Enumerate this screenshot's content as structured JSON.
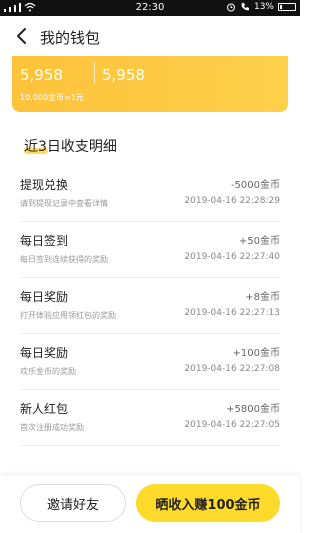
{
  "status_bar": {
    "time": "22:30",
    "battery": "13%"
  },
  "header": {
    "title": "我的钱包"
  },
  "balance_card": {
    "coins": "5,958",
    "coins_secondary": "5,958",
    "rate_text": "10,000金币=1元"
  },
  "section": {
    "title": "近3日收支明细"
  },
  "records": [
    {
      "title": "提现兑换",
      "desc": "请到提现记录中查看详情",
      "amount": "-5000金币",
      "time": "2019-04-16 22:28:29"
    },
    {
      "title": "每日签到",
      "desc": "每日签到连续获得的奖励",
      "amount": "+50金币",
      "time": "2019-04-16 22:27:40"
    },
    {
      "title": "每日奖励",
      "desc": "打开体验应用领红包的奖励",
      "amount": "+8金币",
      "time": "2019-04-16 22:27:13"
    },
    {
      "title": "每日奖励",
      "desc": "欢乐金币的奖励",
      "amount": "+100金币",
      "time": "2019-04-16 22:27:08"
    },
    {
      "title": "新人红包",
      "desc": "首次注册成功奖励",
      "amount": "+5800金币",
      "time": "2019-04-16 22:27:05"
    }
  ],
  "bottom": {
    "invite_label": "邀请好友",
    "share_label": "晒收入赚100金币"
  },
  "colors": {
    "accent": "#fdc33a",
    "button_yellow": "#fedb2b"
  }
}
